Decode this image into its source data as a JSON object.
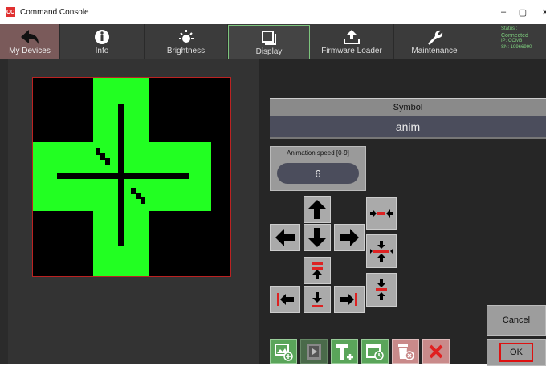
{
  "window": {
    "title": "Command Console",
    "app_icon_text": "CC",
    "minimize": "–",
    "maximize": "▢",
    "close": "✕"
  },
  "toolbar": {
    "items": [
      {
        "label": "My Devices",
        "icon": "back-arrow-icon"
      },
      {
        "label": "Info",
        "icon": "info-icon"
      },
      {
        "label": "Brightness",
        "icon": "sun-icon"
      },
      {
        "label": "Display",
        "icon": "display-icon"
      },
      {
        "label": "Firmware Loader",
        "icon": "upload-icon"
      },
      {
        "label": "Maintenance",
        "icon": "wrench-icon"
      }
    ],
    "status": {
      "label": "Status :",
      "state": "Connected",
      "ip": "IP: COM3",
      "sn": "SN: 19966990"
    }
  },
  "symbol": {
    "header": "Symbol",
    "value": "anim"
  },
  "speed": {
    "label": "Animation speed [0-9]",
    "value": "6"
  },
  "dialog": {
    "cancel_label": "Cancel",
    "ok_label": "OK"
  },
  "colors": {
    "pixel_on": "#22ff22",
    "pixel_off": "#000000",
    "accent_red": "#dd2222",
    "status_green": "#7fd07f"
  }
}
